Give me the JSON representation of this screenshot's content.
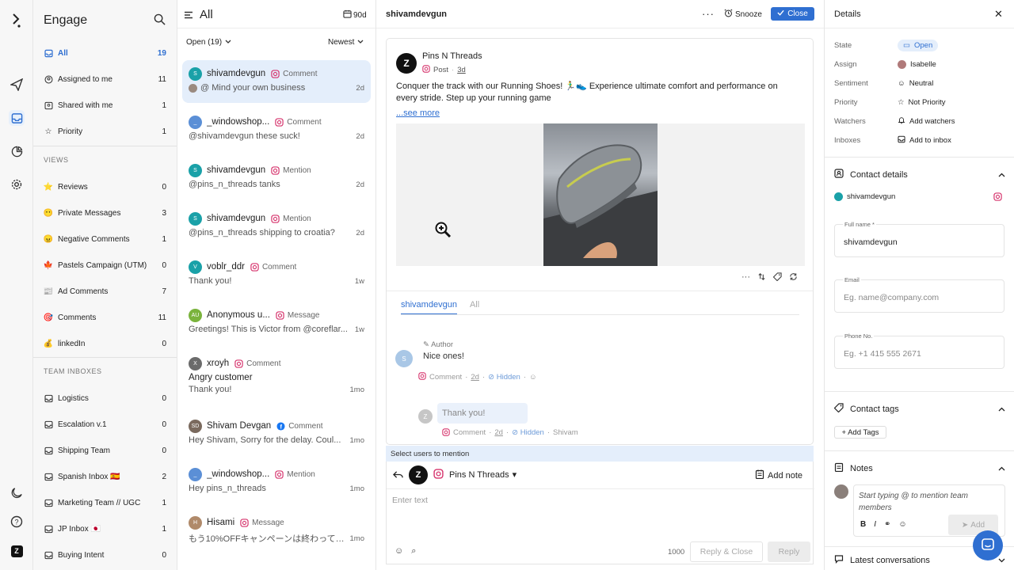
{
  "app": {
    "title": "Engage"
  },
  "sidebar": {
    "items": [
      {
        "label": "All",
        "count": "19",
        "icon": "inbox-icon",
        "selected": true
      },
      {
        "label": "Assigned to me",
        "count": "11",
        "icon": "user-circle-icon"
      },
      {
        "label": "Shared with me",
        "count": "1",
        "icon": "users-icon"
      },
      {
        "label": "Priority",
        "count": "1",
        "icon": "star-icon"
      }
    ],
    "views_title": "VIEWS",
    "views": [
      {
        "label": "Reviews",
        "count": "0",
        "icon": "⭐"
      },
      {
        "label": "Private Messages",
        "count": "3",
        "icon": "😶"
      },
      {
        "label": "Negative Comments",
        "count": "1",
        "icon": "😠"
      },
      {
        "label": "Pastels Campaign (UTM)",
        "count": "0",
        "icon": "🍁"
      },
      {
        "label": "Ad Comments",
        "count": "7",
        "icon": "📰"
      },
      {
        "label": "Comments",
        "count": "11",
        "icon": "🎯"
      },
      {
        "label": "linkedIn",
        "count": "0",
        "icon": "💰"
      }
    ],
    "team_title": "TEAM INBOXES",
    "team": [
      {
        "label": "Logistics",
        "count": "0"
      },
      {
        "label": "Escalation v.1",
        "count": "0"
      },
      {
        "label": "Shipping Team",
        "count": "0"
      },
      {
        "label": "Spanish Inbox 🇪🇸",
        "count": "2"
      },
      {
        "label": "Marketing Team // UGC",
        "count": "1"
      },
      {
        "label": "JP Inbox 🇯🇵",
        "count": "1"
      },
      {
        "label": "Buying Intent",
        "count": "0"
      }
    ]
  },
  "list": {
    "title": "All",
    "range": "90d",
    "filter": "Open (19)",
    "sort": "Newest",
    "items": [
      {
        "avatar": "S",
        "color": "#1aa1a8",
        "name": "shivamdevgun",
        "type": "Comment",
        "preview": "@ Mind your own business",
        "time": "2d",
        "selected": true
      },
      {
        "avatar": "_",
        "color": "#5b8fd6",
        "name": "_windowshop...",
        "type": "Comment",
        "preview": "@shivamdevgun these suck!",
        "time": "2d"
      },
      {
        "avatar": "S",
        "color": "#1aa1a8",
        "name": "shivamdevgun",
        "type": "Mention",
        "preview": "@pins_n_threads tanks",
        "time": "2d"
      },
      {
        "avatar": "S",
        "color": "#1aa1a8",
        "name": "shivamdevgun",
        "type": "Mention",
        "preview": "@pins_n_threads shipping to croatia?",
        "time": "2d"
      },
      {
        "avatar": "V",
        "color": "#1aa1a8",
        "name": "voblr_ddr",
        "type": "Comment",
        "preview": "Thank you!",
        "time": "1w"
      },
      {
        "avatar": "AU",
        "color": "#7ab33c",
        "name": "Anonymous u...",
        "type": "Message",
        "preview": "Greetings! This is Victor from @coreflar...",
        "time": "1w"
      },
      {
        "avatar": "X",
        "color": "#6b6b6b",
        "name": "xroyh",
        "type": "Comment",
        "subject": "Angry customer",
        "preview": "Thank you!",
        "time": "1mo"
      },
      {
        "avatar": "SD",
        "color": "#7a6a5e",
        "name": "Shivam Devgan",
        "type": "Comment",
        "preview": "Hey Shivam, Sorry for the delay. Coul...",
        "time": "1mo"
      },
      {
        "avatar": "_",
        "color": "#5b8fd6",
        "name": "_windowshop...",
        "type": "Mention",
        "preview": "Hey pins_n_threads",
        "time": "1mo"
      },
      {
        "avatar": "H",
        "color": "#b08a6a",
        "name": "Hisami",
        "type": "Message",
        "preview": "もう10%OFFキャンペーンは終わってし...",
        "time": "1mo"
      }
    ]
  },
  "main": {
    "name": "shivamdevgun",
    "snooze": "Snooze",
    "close": "Close",
    "post": {
      "author": "Pins N Threads",
      "kind": "Post",
      "time": "3d",
      "text": "Conquer the track with our Running Shoes! 🏃‍♂️👟 Experience ultimate comfort and performance on every stride. Step up your running game",
      "see_more": "...see more"
    },
    "tabs": [
      "shivamdevgun",
      "All"
    ],
    "comment": {
      "avatar": "S",
      "author_label": "Author",
      "text": "Nice ones!",
      "kind": "Comment",
      "time": "2d",
      "status": "Hidden"
    },
    "reply": {
      "text": "Thank you!",
      "kind": "Comment",
      "time": "2d",
      "status": "Hidden",
      "by": "Shivam"
    },
    "mention_bar": "Select users to mention",
    "composer": {
      "account": "Pins N Threads",
      "add_note": "Add note",
      "placeholder": "Enter text",
      "count": "1000",
      "reply_close": "Reply & Close",
      "reply": "Reply"
    }
  },
  "details": {
    "title": "Details",
    "props": [
      {
        "key": "State",
        "value": "Open",
        "icon": "inbox-icon"
      },
      {
        "key": "Assign",
        "value": "Isabelle",
        "icon": "avatar"
      },
      {
        "key": "Sentiment",
        "value": "Neutral",
        "icon": "neutral-face-icon"
      },
      {
        "key": "Priority",
        "value": "Not Priority",
        "icon": "star-icon"
      },
      {
        "key": "Watchers",
        "value": "Add watchers",
        "icon": "bell-icon"
      },
      {
        "key": "Inboxes",
        "value": "Add to inbox",
        "icon": "inbox-icon"
      }
    ],
    "contact_title": "Contact details",
    "contact_name": "shivamdevgun",
    "fields": [
      {
        "label": "Full name *",
        "value": "shivamdevgun",
        "placeholder": false
      },
      {
        "label": "Email",
        "value": "Eg. name@company.com",
        "placeholder": true
      },
      {
        "label": "Phone No.",
        "value": "Eg. +1 415 555 2671",
        "placeholder": true
      }
    ],
    "tags_title": "Contact tags",
    "add_tags": "+ Add Tags",
    "notes_title": "Notes",
    "note_placeholder": "Start typing @ to mention team members",
    "note_add": "Add",
    "latest_title": "Latest conversations"
  }
}
